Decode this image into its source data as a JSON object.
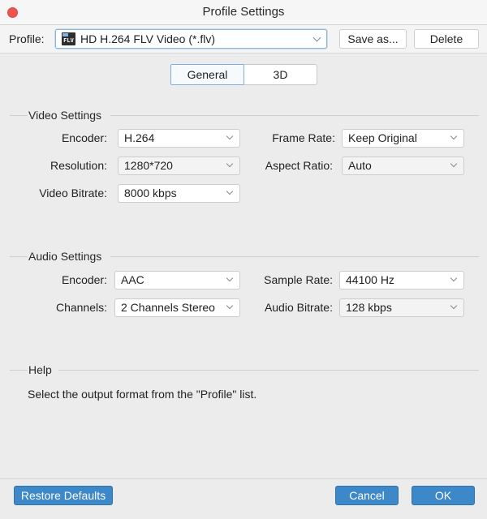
{
  "window": {
    "title": "Profile Settings"
  },
  "toolbar": {
    "profile_label": "Profile:",
    "profile_icon": "flv-file-icon",
    "profile_icon_text": "FLV",
    "profile_value": "HD H.264 FLV Video (*.flv)",
    "save_as_label": "Save as...",
    "delete_label": "Delete"
  },
  "tabs": [
    {
      "label": "General",
      "active": true
    },
    {
      "label": "3D",
      "active": false
    }
  ],
  "video": {
    "title": "Video Settings",
    "encoder": {
      "label": "Encoder:",
      "value": "H.264"
    },
    "resolution": {
      "label": "Resolution:",
      "value": "1280*720"
    },
    "bitrate": {
      "label": "Video Bitrate:",
      "value": "8000 kbps"
    },
    "frame_rate": {
      "label": "Frame Rate:",
      "value": "Keep Original"
    },
    "aspect_ratio": {
      "label": "Aspect Ratio:",
      "value": "Auto"
    }
  },
  "audio": {
    "title": "Audio Settings",
    "encoder": {
      "label": "Encoder:",
      "value": "AAC"
    },
    "channels": {
      "label": "Channels:",
      "value": "2 Channels Stereo"
    },
    "sample_rate": {
      "label": "Sample Rate:",
      "value": "44100 Hz"
    },
    "bitrate": {
      "label": "Audio Bitrate:",
      "value": "128 kbps"
    }
  },
  "help": {
    "title": "Help",
    "text": "Select the output format from the \"Profile\" list."
  },
  "footer": {
    "restore_label": "Restore Defaults",
    "cancel_label": "Cancel",
    "ok_label": "OK"
  },
  "colors": {
    "accent_button": "#3c88c8",
    "close_button": "#ef5350",
    "focus_ring": "#8ab3d6"
  }
}
